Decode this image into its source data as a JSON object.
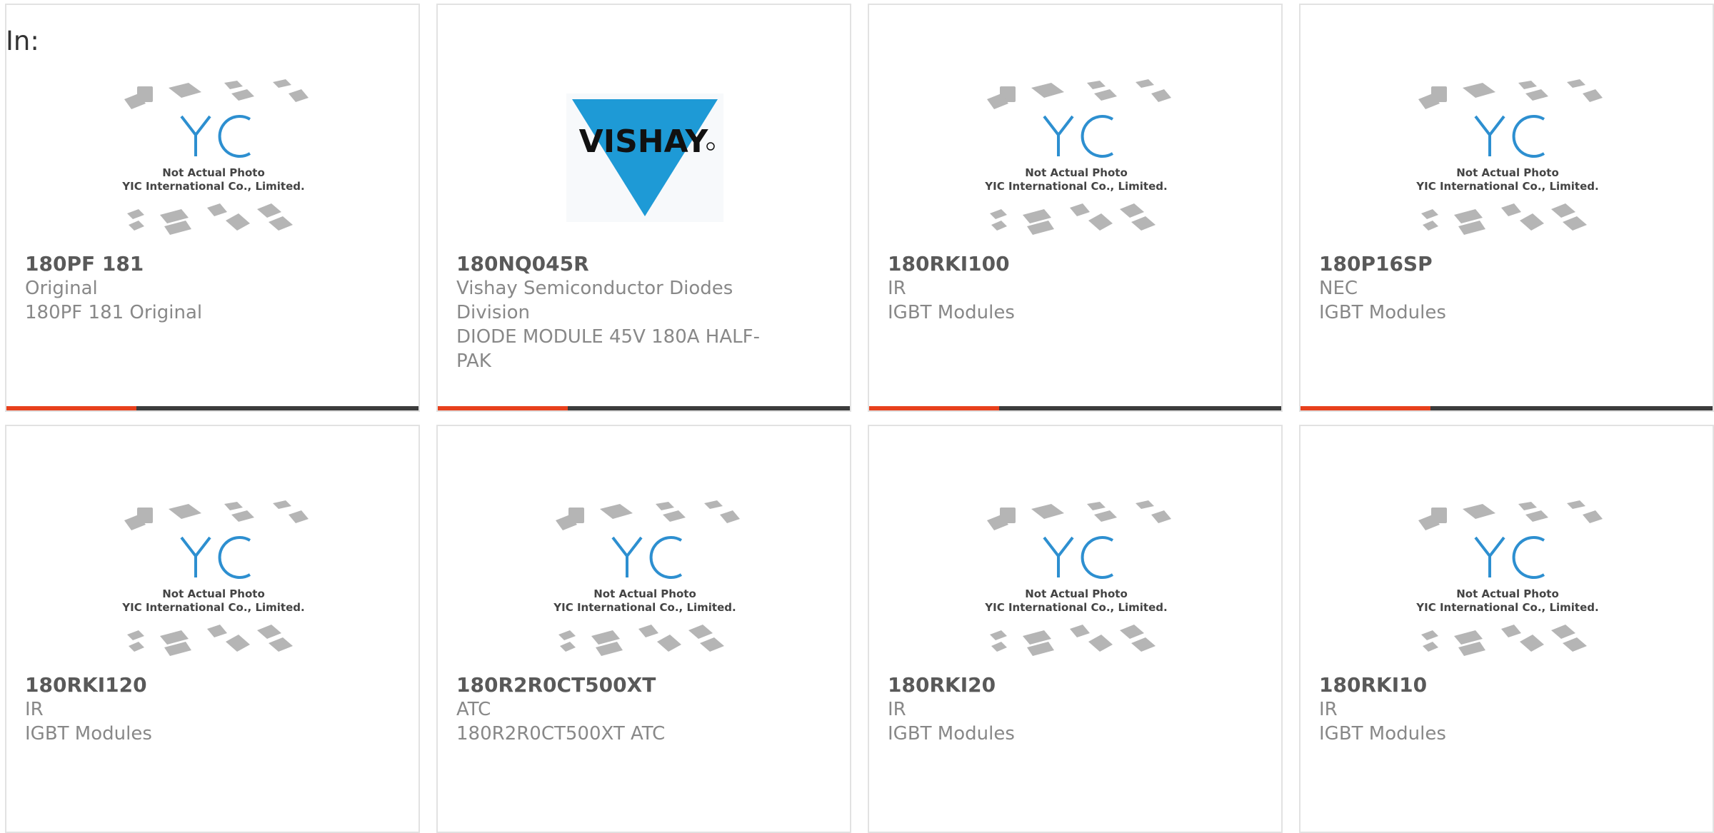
{
  "filter": {
    "in_label": "In:"
  },
  "placeholder_image": {
    "caption_line1": "Not Actual Photo",
    "caption_line2": "YIC International Co., Limited."
  },
  "vishay_logo_text": "VISHAY",
  "colors": {
    "accent": "#e8401c",
    "bar": "#3c3c3c",
    "logo_blue": "#2d8fd0",
    "vishay_blue": "#1e9ad6"
  },
  "products": [
    {
      "part": "180PF 181",
      "manufacturer": "Original",
      "description": "180PF 181 Original",
      "image": "yic-placeholder"
    },
    {
      "part": "180NQ045R",
      "manufacturer": "Vishay Semiconductor Diodes Division",
      "description": "DIODE MODULE 45V 180A HALF-PAK",
      "image": "vishay-logo"
    },
    {
      "part": "180RKI100",
      "manufacturer": "IR",
      "description": "IGBT Modules",
      "image": "yic-placeholder"
    },
    {
      "part": "180P16SP",
      "manufacturer": "NEC",
      "description": "IGBT Modules",
      "image": "yic-placeholder"
    },
    {
      "part": "180RKI120",
      "manufacturer": "IR",
      "description": "IGBT Modules",
      "image": "yic-placeholder"
    },
    {
      "part": "180R2R0CT500XT",
      "manufacturer": "ATC",
      "description": "180R2R0CT500XT ATC",
      "image": "yic-placeholder"
    },
    {
      "part": "180RKI20",
      "manufacturer": "IR",
      "description": "IGBT Modules",
      "image": "yic-placeholder"
    },
    {
      "part": "180RKI10",
      "manufacturer": "IR",
      "description": "IGBT Modules",
      "image": "yic-placeholder"
    }
  ]
}
